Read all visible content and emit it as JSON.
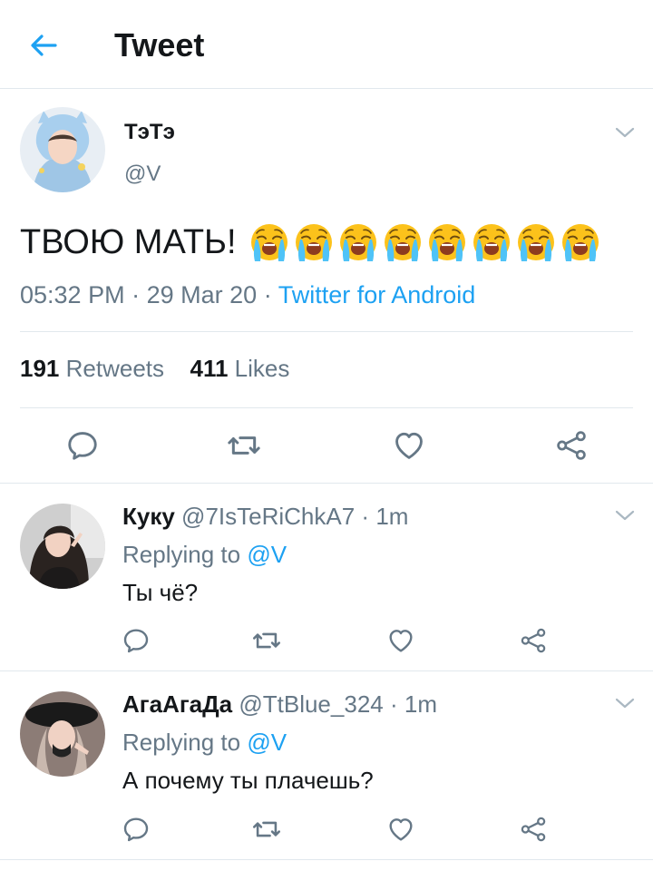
{
  "header": {
    "title": "Tweet",
    "back_icon": "arrow-left-icon"
  },
  "colors": {
    "accent": "#1da1f2",
    "text": "#14171a",
    "secondary": "#657786",
    "divider": "#e1e8ed"
  },
  "tweet": {
    "name": "ТэТэ",
    "handle": "@V",
    "text": "ТВОЮ МАТЬ!",
    "emoji_name": "loudly-crying-face",
    "emoji_count": 8,
    "time": "05:32 PM",
    "date": "29 Mar 20",
    "separator": "·",
    "client": "Twitter for Android",
    "retweets_count": "191",
    "retweets_label": "Retweets",
    "likes_count": "411",
    "likes_label": "Likes",
    "actions": [
      "reply-icon",
      "retweet-icon",
      "like-icon",
      "share-icon"
    ]
  },
  "replies": [
    {
      "name": "Куку",
      "handle": "@7IsTeRiChkA7",
      "time_ago": "1m",
      "replying_label": "Replying to",
      "replying_to": "@V",
      "text": "Ты чё?"
    },
    {
      "name": "АгаАгаДа",
      "handle": "@TtBlue_324",
      "time_ago": "1m",
      "replying_label": "Replying to",
      "replying_to": "@V",
      "text": "А почему ты плачешь?"
    }
  ]
}
